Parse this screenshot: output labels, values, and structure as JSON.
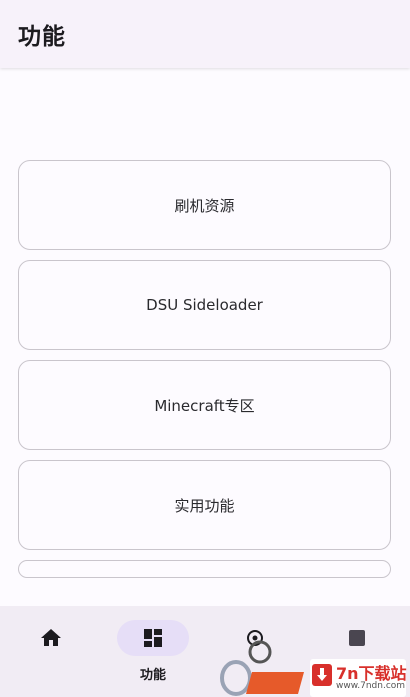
{
  "app_bar": {
    "title": "功能"
  },
  "cards": [
    {
      "label": "刷机资源"
    },
    {
      "label": "DSU Sideloader"
    },
    {
      "label": "Minecraft专区"
    },
    {
      "label": "实用功能"
    },
    {
      "label": ""
    }
  ],
  "bottom_nav": {
    "items": [
      {
        "icon": "home-icon",
        "label": "",
        "active": false
      },
      {
        "icon": "dashboard-icon",
        "label": "功能",
        "active": true
      },
      {
        "icon": "settings-icon",
        "label": "",
        "active": false
      },
      {
        "icon": "info-icon",
        "label": "",
        "active": false
      }
    ]
  },
  "watermark": {
    "brand": "7n下载站",
    "url": "www.7ndn.com"
  },
  "colors": {
    "app_bar_bg": "#f7f2fa",
    "nav_bg": "#f1ecf4",
    "active_indicator": "#e6def7",
    "card_border": "#c9c5cc",
    "watermark_red": "#d8302b"
  }
}
